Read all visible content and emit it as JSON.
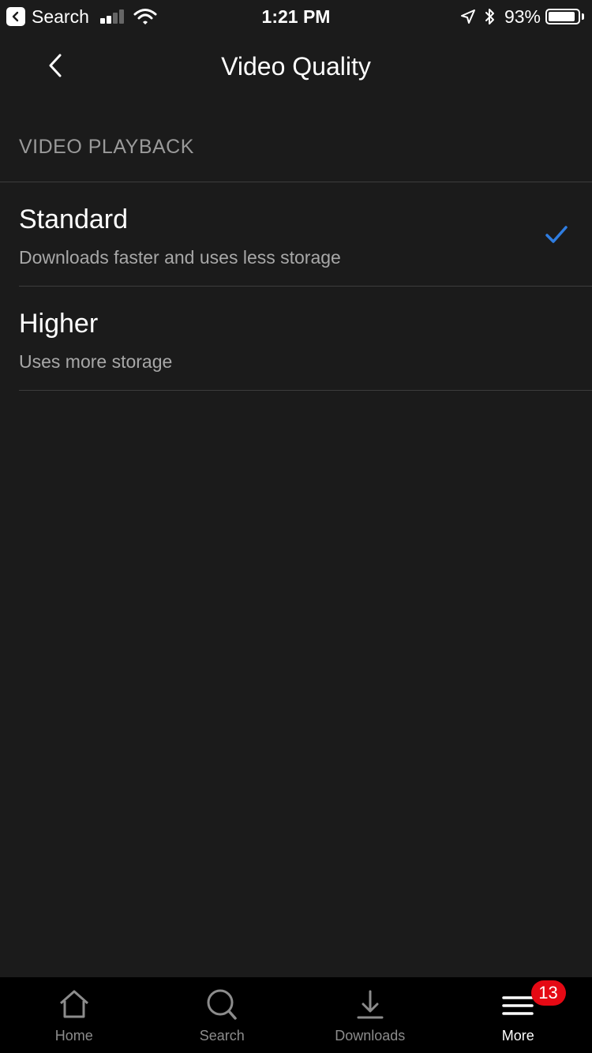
{
  "status_bar": {
    "back_app_label": "Search",
    "time": "1:21 PM",
    "battery_percent": "93%",
    "battery_level": 0.93,
    "signal_bars_active": 2,
    "signal_bars_total": 4
  },
  "nav": {
    "title": "Video Quality",
    "back_icon": "chevron-left-icon"
  },
  "section": {
    "header": "VIDEO PLAYBACK"
  },
  "options": [
    {
      "title": "Standard",
      "subtitle": "Downloads faster and uses less storage",
      "selected": true
    },
    {
      "title": "Higher",
      "subtitle": "Uses more storage",
      "selected": false
    }
  ],
  "tabs": [
    {
      "label": "Home",
      "icon": "home-icon",
      "active": false
    },
    {
      "label": "Search",
      "icon": "search-icon",
      "active": false
    },
    {
      "label": "Downloads",
      "icon": "download-icon",
      "active": false
    },
    {
      "label": "More",
      "icon": "menu-icon",
      "active": true,
      "badge": "13"
    }
  ],
  "colors": {
    "background": "#1b1b1b",
    "tab_bar": "#000000",
    "check": "#2f7de1",
    "badge": "#e50914",
    "muted_text": "#a8a8a8"
  }
}
